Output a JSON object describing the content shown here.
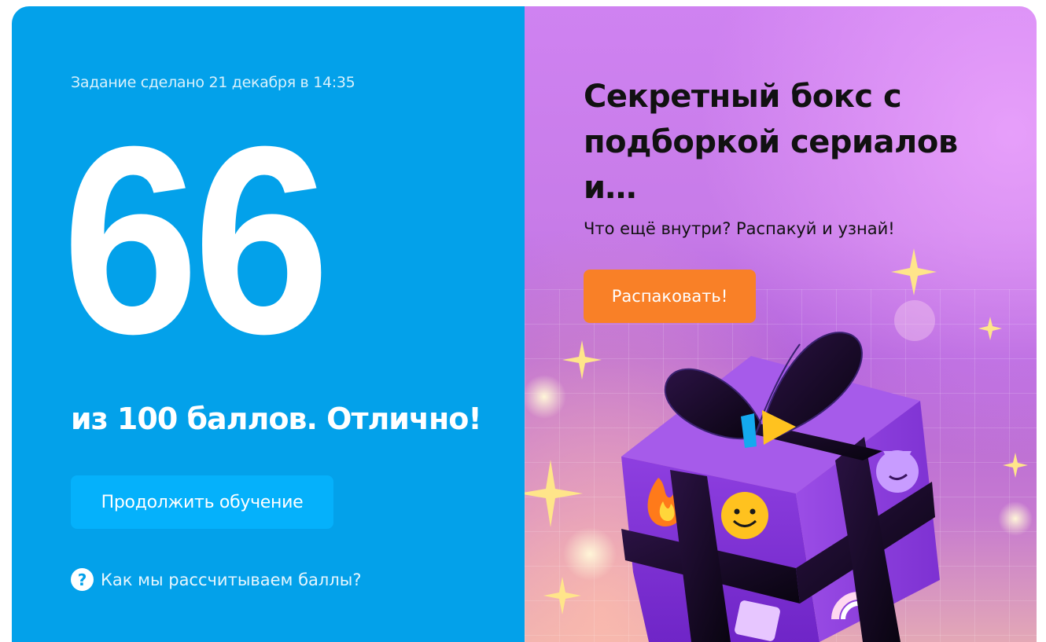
{
  "result": {
    "completed_text": "Задание сделано 21 декабря в 14:35",
    "score": "66",
    "score_caption": "из 100 баллов. Отлично!",
    "continue_label": "Продолжить обучение",
    "help_icon": "?",
    "help_label": "Как мы рассчитываем баллы?"
  },
  "promo": {
    "title": "Секретный бокс с подборкой сериалов и…",
    "subtitle": "Что ещё внутри? Распакуй и узнай!",
    "button_label": "Распаковать!"
  },
  "colors": {
    "left_bg": "#03a1ea",
    "button_bg": "#05b1fb",
    "promo_button_bg": "#f98027",
    "gift_box": "#8a35d6"
  },
  "icons": {
    "help": "question-circle-icon",
    "gift": "gift-box-illustration"
  }
}
